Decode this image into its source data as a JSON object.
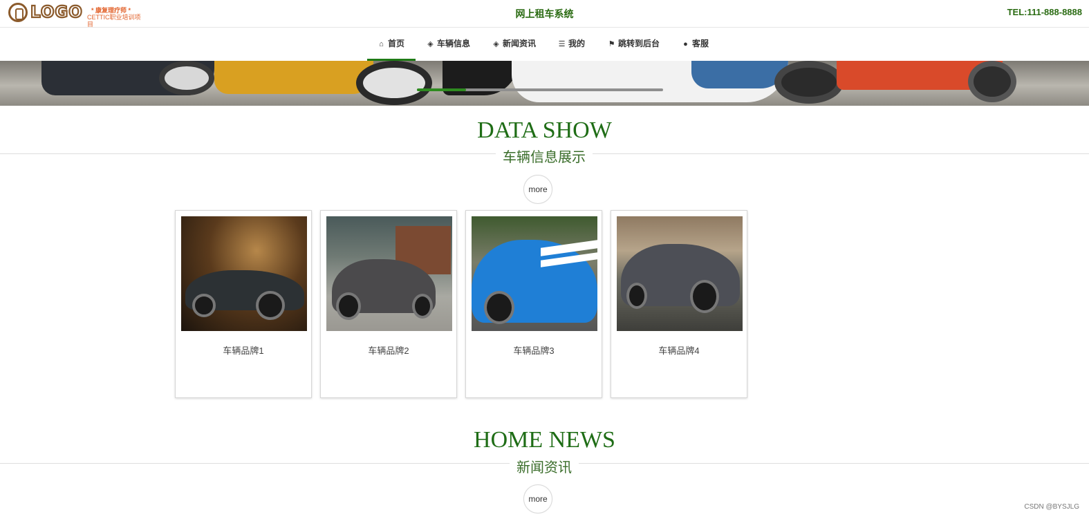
{
  "header": {
    "logo_text": "LOGO",
    "logo_line1": "* 康复理疗师 *",
    "logo_line2": "CETTIC职业培训项目",
    "site_title": "网上租车系统",
    "tel": "TEL:111-888-8888"
  },
  "nav": {
    "items": [
      {
        "label": "首页",
        "icon": "home-icon",
        "active": true
      },
      {
        "label": "车辆信息",
        "icon": "layers-icon"
      },
      {
        "label": "新闻资讯",
        "icon": "layers-icon"
      },
      {
        "label": "我的",
        "icon": "list-icon"
      },
      {
        "label": "跳转到后台",
        "icon": "flag-icon"
      },
      {
        "label": "客服",
        "icon": "support-icon"
      }
    ]
  },
  "banner": {
    "slider_progress": 0.2
  },
  "data_show": {
    "title": "DATA SHOW",
    "subtitle": "车辆信息展示",
    "more": "more",
    "cards": [
      {
        "label": "车辆品牌1"
      },
      {
        "label": "车辆品牌2"
      },
      {
        "label": "车辆品牌3"
      },
      {
        "label": "车辆品牌4"
      }
    ]
  },
  "home_news": {
    "title": "HOME NEWS",
    "subtitle": "新闻资讯",
    "more": "more"
  },
  "watermark": "CSDN @BYSJLG",
  "colors": {
    "accent": "#1f7a16",
    "title_green": "#2a6b12",
    "logo_orange": "#e2622b",
    "logo_brown": "#8b5a2b"
  }
}
